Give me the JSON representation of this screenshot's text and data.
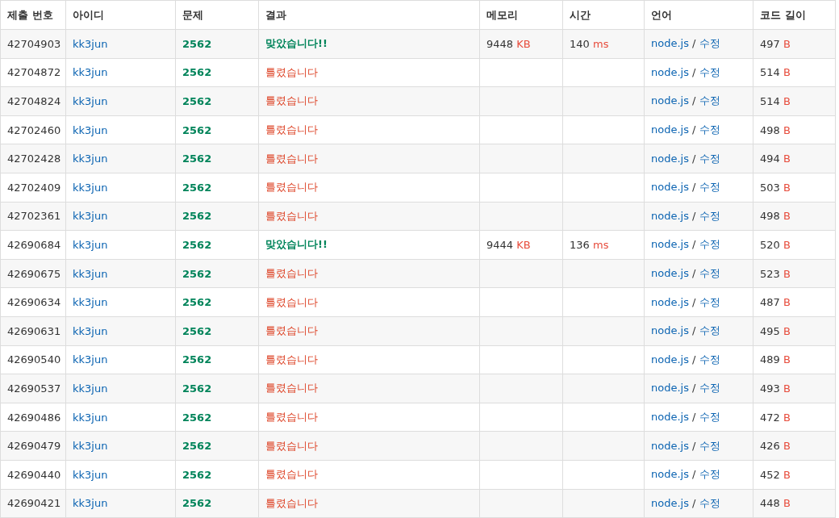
{
  "columns": [
    "제출 번호",
    "아이디",
    "문제",
    "결과",
    "메모리",
    "시간",
    "언어",
    "코드 길이"
  ],
  "rows": [
    {
      "id": "42704903",
      "user": "kk3jun",
      "problem": "2562",
      "result": {
        "kind": "accepted",
        "text": "맞았습니다!!"
      },
      "memory": {
        "value": "9448",
        "unit": "KB"
      },
      "time": {
        "value": "140",
        "unit": "ms"
      },
      "language": "node.js",
      "separator": "/",
      "edit": "수정",
      "length": {
        "value": "497",
        "unit": "B"
      }
    },
    {
      "id": "42704872",
      "user": "kk3jun",
      "problem": "2562",
      "result": {
        "kind": "wrong",
        "text": "틀렸습니다"
      },
      "language": "node.js",
      "separator": "/",
      "edit": "수정",
      "length": {
        "value": "514",
        "unit": "B"
      }
    },
    {
      "id": "42704824",
      "user": "kk3jun",
      "problem": "2562",
      "result": {
        "kind": "wrong",
        "text": "틀렸습니다"
      },
      "language": "node.js",
      "separator": "/",
      "edit": "수정",
      "length": {
        "value": "514",
        "unit": "B"
      }
    },
    {
      "id": "42702460",
      "user": "kk3jun",
      "problem": "2562",
      "result": {
        "kind": "wrong",
        "text": "틀렸습니다"
      },
      "language": "node.js",
      "separator": "/",
      "edit": "수정",
      "length": {
        "value": "498",
        "unit": "B"
      }
    },
    {
      "id": "42702428",
      "user": "kk3jun",
      "problem": "2562",
      "result": {
        "kind": "wrong",
        "text": "틀렸습니다"
      },
      "language": "node.js",
      "separator": "/",
      "edit": "수정",
      "length": {
        "value": "494",
        "unit": "B"
      }
    },
    {
      "id": "42702409",
      "user": "kk3jun",
      "problem": "2562",
      "result": {
        "kind": "wrong",
        "text": "틀렸습니다"
      },
      "language": "node.js",
      "separator": "/",
      "edit": "수정",
      "length": {
        "value": "503",
        "unit": "B"
      }
    },
    {
      "id": "42702361",
      "user": "kk3jun",
      "problem": "2562",
      "result": {
        "kind": "wrong",
        "text": "틀렸습니다"
      },
      "language": "node.js",
      "separator": "/",
      "edit": "수정",
      "length": {
        "value": "498",
        "unit": "B"
      }
    },
    {
      "id": "42690684",
      "user": "kk3jun",
      "problem": "2562",
      "result": {
        "kind": "accepted",
        "text": "맞았습니다!!"
      },
      "memory": {
        "value": "9444",
        "unit": "KB"
      },
      "time": {
        "value": "136",
        "unit": "ms"
      },
      "language": "node.js",
      "separator": "/",
      "edit": "수정",
      "length": {
        "value": "520",
        "unit": "B"
      }
    },
    {
      "id": "42690675",
      "user": "kk3jun",
      "problem": "2562",
      "result": {
        "kind": "wrong",
        "text": "틀렸습니다"
      },
      "language": "node.js",
      "separator": "/",
      "edit": "수정",
      "length": {
        "value": "523",
        "unit": "B"
      }
    },
    {
      "id": "42690634",
      "user": "kk3jun",
      "problem": "2562",
      "result": {
        "kind": "wrong",
        "text": "틀렸습니다"
      },
      "language": "node.js",
      "separator": "/",
      "edit": "수정",
      "length": {
        "value": "487",
        "unit": "B"
      }
    },
    {
      "id": "42690631",
      "user": "kk3jun",
      "problem": "2562",
      "result": {
        "kind": "wrong",
        "text": "틀렸습니다"
      },
      "language": "node.js",
      "separator": "/",
      "edit": "수정",
      "length": {
        "value": "495",
        "unit": "B"
      }
    },
    {
      "id": "42690540",
      "user": "kk3jun",
      "problem": "2562",
      "result": {
        "kind": "wrong",
        "text": "틀렸습니다"
      },
      "language": "node.js",
      "separator": "/",
      "edit": "수정",
      "length": {
        "value": "489",
        "unit": "B"
      }
    },
    {
      "id": "42690537",
      "user": "kk3jun",
      "problem": "2562",
      "result": {
        "kind": "wrong",
        "text": "틀렸습니다"
      },
      "language": "node.js",
      "separator": "/",
      "edit": "수정",
      "length": {
        "value": "493",
        "unit": "B"
      }
    },
    {
      "id": "42690486",
      "user": "kk3jun",
      "problem": "2562",
      "result": {
        "kind": "wrong",
        "text": "틀렸습니다"
      },
      "language": "node.js",
      "separator": "/",
      "edit": "수정",
      "length": {
        "value": "472",
        "unit": "B"
      }
    },
    {
      "id": "42690479",
      "user": "kk3jun",
      "problem": "2562",
      "result": {
        "kind": "wrong",
        "text": "틀렸습니다"
      },
      "language": "node.js",
      "separator": "/",
      "edit": "수정",
      "length": {
        "value": "426",
        "unit": "B"
      }
    },
    {
      "id": "42690440",
      "user": "kk3jun",
      "problem": "2562",
      "result": {
        "kind": "wrong",
        "text": "틀렸습니다"
      },
      "language": "node.js",
      "separator": "/",
      "edit": "수정",
      "length": {
        "value": "452",
        "unit": "B"
      }
    },
    {
      "id": "42690421",
      "user": "kk3jun",
      "problem": "2562",
      "result": {
        "kind": "wrong",
        "text": "틀렸습니다"
      },
      "language": "node.js",
      "separator": "/",
      "edit": "수정",
      "length": {
        "value": "448",
        "unit": "B"
      }
    }
  ]
}
